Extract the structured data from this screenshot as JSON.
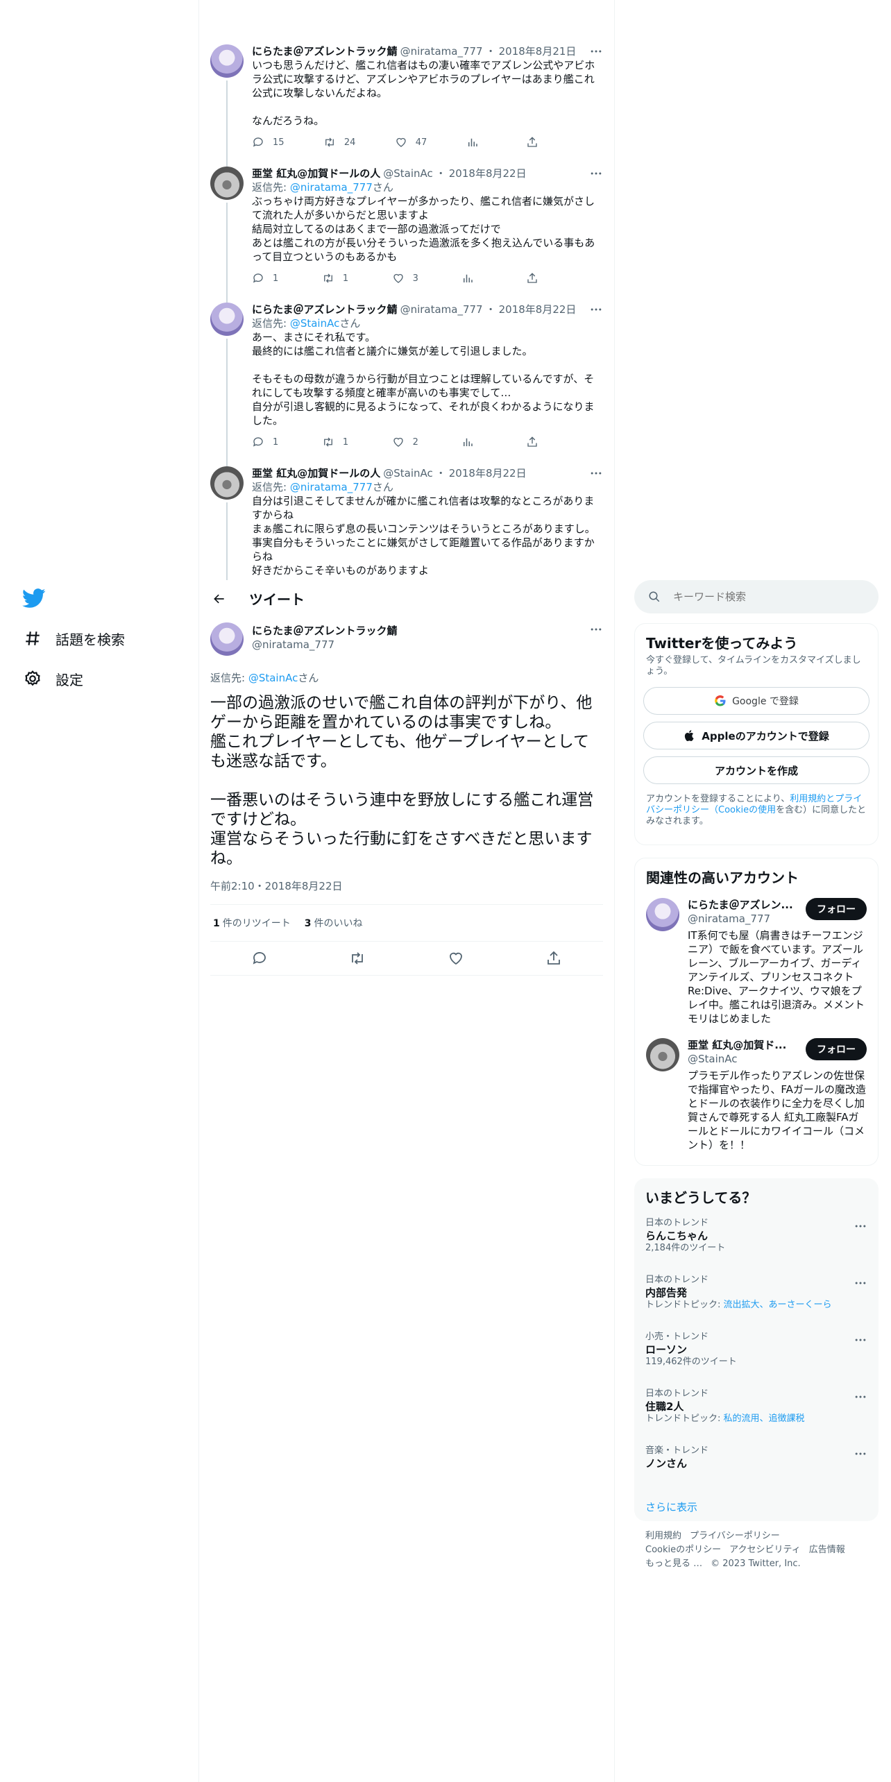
{
  "nav": {
    "explore": "話題を検索",
    "settings": "設定"
  },
  "thread": [
    {
      "name": "にらたま＠アズレントラック鯖",
      "handle": "@niratama_777",
      "sep": "・",
      "date": "2018年8月21日",
      "reply_prefix": "",
      "reply_user": "",
      "reply_suffix": "",
      "text": "いつも思うんだけど、艦これ信者はもの凄い確率でアズレン公式やアビホラ公式に攻撃するけど、アズレンやアビホラのプレイヤーはあまり艦これ公式に攻撃しないんだよね。\n\nなんだろうね。",
      "replies": "15",
      "retweets": "24",
      "likes": "47"
    },
    {
      "name": "亜堂 紅丸@加賀ドールの人",
      "handle": "@StainAc",
      "sep": "・",
      "date": "2018年8月22日",
      "reply_prefix": "返信先: ",
      "reply_user": "@niratama_777",
      "reply_suffix": "さん",
      "text": "ぶっちゃけ両方好きなプレイヤーが多かったり、艦これ信者に嫌気がさして流れた人が多いからだと思いますよ\n結局対立してるのはあくまで一部の過激派ってだけで\nあとは艦これの方が長い分そういった過激派を多く抱え込んでいる事もあって目立つというのもあるかも",
      "replies": "1",
      "retweets": "1",
      "likes": "3"
    },
    {
      "name": "にらたま＠アズレントラック鯖",
      "handle": "@niratama_777",
      "sep": "・",
      "date": "2018年8月22日",
      "reply_prefix": "返信先: ",
      "reply_user": "@StainAc",
      "reply_suffix": "さん",
      "text": "あー、まさにそれ私です。\n最終的には艦これ信者と議介に嫌気が差して引退しました。\n\nそもそもの母数が違うから行動が目立つことは理解しているんですが、それにしても攻撃する頻度と確率が高いのも事実でして…\n自分が引退し客観的に見るようになって、それが良くわかるようになりました。",
      "replies": "1",
      "retweets": "1",
      "likes": "2"
    },
    {
      "name": "亜堂 紅丸@加賀ドールの人",
      "handle": "@StainAc",
      "sep": "・",
      "date": "2018年8月22日",
      "reply_prefix": "返信先: ",
      "reply_user": "@niratama_777",
      "reply_suffix": "さん",
      "text": "自分は引退こそしてませんが確かに艦これ信者は攻撃的なところがありますからね\nまぁ艦これに限らず息の長いコンテンツはそういうところがありますし。事実自分もそういったことに嫌気がさして距離置いてる作品がありますからね\n好きだからこそ辛いものがありますよ",
      "replies": "",
      "retweets": "",
      "likes": ""
    }
  ],
  "header": {
    "title": "ツイート"
  },
  "main": {
    "name": "にらたま＠アズレントラック鯖",
    "handle": "@niratama_777",
    "reply_prefix": "返信先: ",
    "reply_user": "@StainAc",
    "reply_suffix": "さん",
    "text": "一部の過激派のせいで艦これ自体の評判が下がり、他ゲーから距離を置かれているのは事実ですしね。\n艦これプレイヤーとしても、他ゲープレイヤーとしても迷惑な話です。\n\n一番悪いのはそういう連中を野放しにする艦これ運営ですけどね。\n運営ならそういった行動に釘をさすべきだと思いますね。",
    "time": "午前2:10・2018年8月22日",
    "retweets": "1",
    "retweets_label": "件のリツイート",
    "likes": "3",
    "likes_label": "件のいいね"
  },
  "search": {
    "placeholder": "キーワード検索"
  },
  "signup": {
    "title": "Twitterを使ってみよう",
    "sub": "今すぐ登録して、タイムラインをカスタマイズしましょう。",
    "google": "Google で登録",
    "apple": "Appleのアカウントで登録",
    "create": "アカウントを作成",
    "terms_pre": "アカウントを登録することにより、",
    "terms_link": "利用規約とプライバシーポリシー（Cookieの使用",
    "terms_post": "を含む）に同意したとみなされます。"
  },
  "related": {
    "title": "関連性の高いアカウント",
    "accounts": [
      {
        "name": "にらたま＠アズレン...",
        "handle": "@niratama_777",
        "follow": "フォロー",
        "bio": "IT系何でも屋（肩書きはチーフエンジニア）で飯を食べています。アズールレーン、ブルーアーカイブ、ガーディアンテイルズ、プリンセスコネクトRe:Dive、アークナイツ、ウマ娘をプレイ中。艦これは引退済み。メメントモリはじめました"
      },
      {
        "name": "亜堂 紅丸@加賀ド...",
        "handle": "@StainAc",
        "follow": "フォロー",
        "bio": "プラモデル作ったりアズレンの佐世保で指揮官やったり、FAガールの魔改造とドールの衣装作りに全力を尽くし加賀さんで尊死する人 紅丸工廠製FAガールとドールにカワイイコール（コメント）を！！"
      }
    ]
  },
  "trends": {
    "title": "いまどうしてる？",
    "items": [
      {
        "context": "日本のトレンド",
        "name": "らんこちゃん",
        "count": "2,184件のツイート",
        "topic_label": "",
        "topic": ""
      },
      {
        "context": "日本のトレンド",
        "name": "内部告発",
        "count": "",
        "topic_label": "トレンドトピック: ",
        "topic": "流出拡大、あーさーくーら"
      },
      {
        "context": "小売・トレンド",
        "name": "ローソン",
        "count": "119,462件のツイート",
        "topic_label": "",
        "topic": ""
      },
      {
        "context": "日本のトレンド",
        "name": "住職2人",
        "count": "",
        "topic_label": "トレンドトピック: ",
        "topic": "私的流用、追徴課税"
      },
      {
        "context": "音楽・トレンド",
        "name": "ノンさん",
        "count": "",
        "topic_label": "",
        "topic": ""
      }
    ],
    "show_more": "さらに表示"
  },
  "footer": {
    "terms": "利用規約",
    "privacy": "プライバシーポリシー",
    "cookie": "Cookieのポリシー",
    "accessibility": "アクセシビリティ",
    "ads": "広告情報",
    "more": "もっと見る …",
    "copyright": "© 2023 Twitter, Inc."
  },
  "colors": {
    "accent": "#1d9bf0",
    "text": "#0f1419",
    "secondary": "#536471"
  }
}
